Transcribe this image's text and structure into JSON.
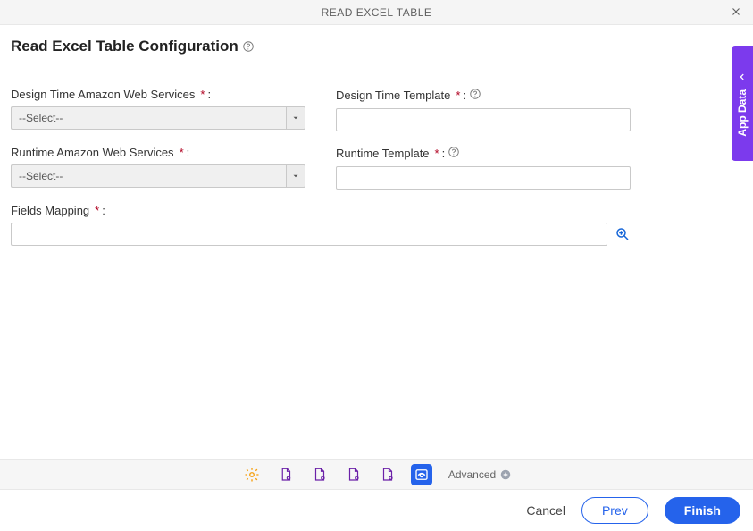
{
  "header": {
    "title": "READ EXCEL TABLE"
  },
  "page": {
    "heading": "Read Excel Table Configuration"
  },
  "sidepanel": {
    "label": "App Data"
  },
  "form": {
    "design_time_aws": {
      "label": "Design Time Amazon Web Services",
      "required_mark": "*",
      "colon": ":",
      "value": "--Select--"
    },
    "runtime_aws": {
      "label": "Runtime Amazon Web Services",
      "required_mark": "*",
      "colon": ":",
      "value": "--Select--"
    },
    "design_time_template": {
      "label": "Design Time Template",
      "required_mark": "*",
      "colon": ":",
      "value": ""
    },
    "runtime_template": {
      "label": "Runtime Template",
      "required_mark": "*",
      "colon": ":",
      "value": ""
    },
    "fields_mapping": {
      "label": "Fields Mapping",
      "required_mark": "*",
      "colon": ":",
      "value": ""
    }
  },
  "toolbar": {
    "advanced_label": "Advanced"
  },
  "actions": {
    "cancel": "Cancel",
    "prev": "Prev",
    "finish": "Finish"
  }
}
